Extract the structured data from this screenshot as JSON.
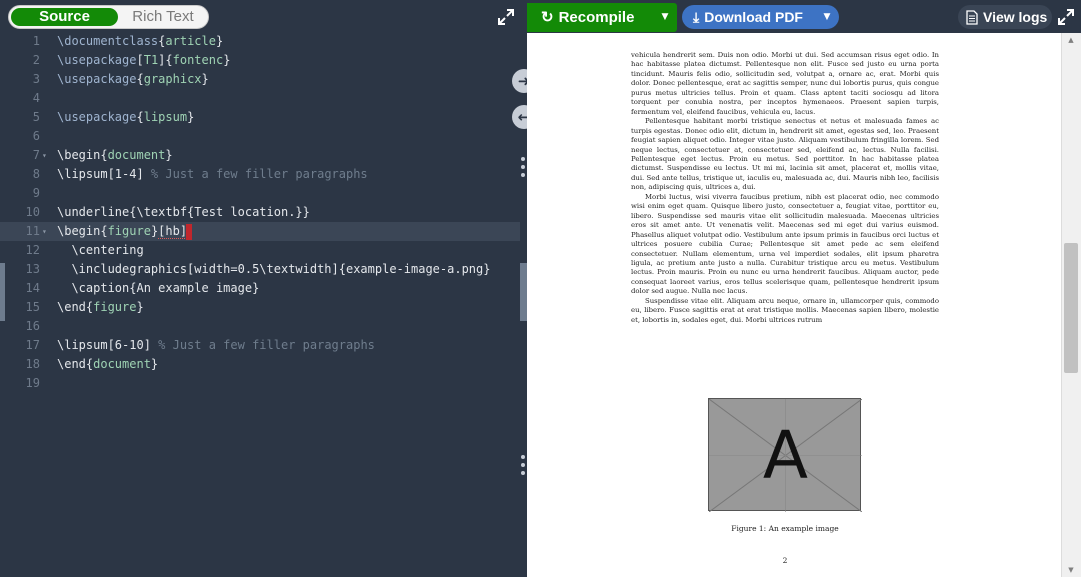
{
  "editor": {
    "mode_source": "Source",
    "mode_rich": "Rich Text",
    "expand_icon": "expand-icon",
    "lines": [
      {
        "n": "1",
        "parts": [
          [
            "cmd",
            "\\documentclass"
          ],
          [
            "kw",
            "{"
          ],
          [
            "arg",
            "article"
          ],
          [
            "kw",
            "}"
          ]
        ]
      },
      {
        "n": "2",
        "parts": [
          [
            "cmd",
            "\\usepackage"
          ],
          [
            "kw",
            "["
          ],
          [
            "arg",
            "T1"
          ],
          [
            "kw",
            "]{"
          ],
          [
            "arg",
            "fontenc"
          ],
          [
            "kw",
            "}"
          ]
        ]
      },
      {
        "n": "3",
        "parts": [
          [
            "cmd",
            "\\usepackage"
          ],
          [
            "kw",
            "{"
          ],
          [
            "arg",
            "graphicx"
          ],
          [
            "kw",
            "}"
          ]
        ]
      },
      {
        "n": "4",
        "parts": []
      },
      {
        "n": "5",
        "parts": [
          [
            "cmd",
            "\\usepackage"
          ],
          [
            "kw",
            "{"
          ],
          [
            "arg",
            "lipsum"
          ],
          [
            "kw",
            "}"
          ]
        ]
      },
      {
        "n": "6",
        "parts": []
      },
      {
        "n": "7",
        "fold": true,
        "parts": [
          [
            "kw",
            "\\begin{"
          ],
          [
            "arg",
            "document"
          ],
          [
            "kw",
            "}"
          ]
        ]
      },
      {
        "n": "8",
        "parts": [
          [
            "kw",
            "\\lipsum[1-4] "
          ],
          [
            "cm",
            "% Just a few filler paragraphs"
          ]
        ]
      },
      {
        "n": "9",
        "parts": []
      },
      {
        "n": "10",
        "parts": [
          [
            "kw",
            "\\underline{\\textbf{Test location.}}"
          ]
        ]
      },
      {
        "n": "11",
        "fold": true,
        "active": true,
        "parts": [
          [
            "kw",
            "\\begin{"
          ],
          [
            "arg",
            "figure"
          ],
          [
            "kw",
            "}"
          ],
          [
            "err",
            "[hb]"
          ]
        ]
      },
      {
        "n": "12",
        "parts": [
          [
            "kw",
            "  \\centering"
          ]
        ]
      },
      {
        "n": "13",
        "parts": [
          [
            "kw",
            "  \\includegraphics[width=0.5\\textwidth]{example-image-a.png}"
          ]
        ]
      },
      {
        "n": "14",
        "parts": [
          [
            "kw",
            "  \\caption{An example image}"
          ]
        ]
      },
      {
        "n": "15",
        "parts": [
          [
            "kw",
            "\\end{"
          ],
          [
            "arg",
            "figure"
          ],
          [
            "kw",
            "}"
          ]
        ]
      },
      {
        "n": "16",
        "parts": []
      },
      {
        "n": "17",
        "parts": [
          [
            "kw",
            "\\lipsum[6-10] "
          ],
          [
            "cm",
            "% Just a few filler paragraphs"
          ]
        ]
      },
      {
        "n": "18",
        "parts": [
          [
            "kw",
            "\\end{"
          ],
          [
            "arg",
            "document"
          ],
          [
            "kw",
            "}"
          ]
        ]
      },
      {
        "n": "19",
        "parts": []
      }
    ]
  },
  "pdf_toolbar": {
    "recompile_label": "Recompile",
    "download_label": "Download PDF",
    "logs_label": "View logs"
  },
  "pdf": {
    "paragraphs": [
      "vehicula hendrerit sem. Duis non odio. Morbi ut dui. Sed accumsan risus eget odio. In hac habitasse platea dictumst. Pellentesque non elit. Fusce sed justo eu urna porta tincidunt. Mauris felis odio, sollicitudin sed, volutpat a, ornare ac, erat. Morbi quis dolor. Donec pellentesque, erat ac sagittis semper, nunc dui lobortis purus, quis congue purus metus ultricies tellus. Proin et quam. Class aptent taciti sociosqu ad litora torquent per conubia nostra, per inceptos hymenaeos. Praesent sapien turpis, fermentum vel, eleifend faucibus, vehicula eu, lacus.",
      "Pellentesque habitant morbi tristique senectus et netus et malesuada fames ac turpis egestas. Donec odio elit, dictum in, hendrerit sit amet, egestas sed, leo. Praesent feugiat sapien aliquet odio. Integer vitae justo. Aliquam vestibulum fringilla lorem. Sed neque lectus, consectetuer at, consectetuer sed, eleifend ac, lectus. Nulla facilisi. Pellentesque eget lectus. Proin eu metus. Sed porttitor. In hac habitasse platea dictumst. Suspendisse eu lectus. Ut mi mi, lacinia sit amet, placerat et, mollis vitae, dui. Sed ante tellus, tristique ut, iaculis eu, malesuada ac, dui. Mauris nibh leo, facilisis non, adipiscing quis, ultrices a, dui.",
      "Morbi luctus, wisi viverra faucibus pretium, nibh est placerat odio, nec commodo wisi enim eget quam. Quisque libero justo, consectetuer a, feugiat vitae, porttitor eu, libero. Suspendisse sed mauris vitae elit sollicitudin malesuada. Maecenas ultricies eros sit amet ante. Ut venenatis velit. Maecenas sed mi eget dui varius euismod. Phasellus aliquet volutpat odio. Vestibulum ante ipsum primis in faucibus orci luctus et ultrices posuere cubilia Curae; Pellentesque sit amet pede ac sem eleifend consectetuer. Nullam elementum, urna vel imperdiet sodales, elit ipsum pharetra ligula, ac pretium ante justo a nulla. Curabitur tristique arcu eu metus. Vestibulum lectus. Proin mauris. Proin eu nunc eu urna hendrerit faucibus. Aliquam auctor, pede consequat laoreet varius, eros tellus scelerisque quam, pellentesque hendrerit ipsum dolor sed augue. Nulla nec lacus.",
      "Suspendisse vitae elit. Aliquam arcu neque, ornare in, ullamcorper quis, commodo eu, libero. Fusce sagittis erat at erat tristique mollis. Maecenas sapien libero, molestie et, lobortis in, sodales eget, dui. Morbi ultrices rutrum"
    ],
    "figure_letter": "A",
    "figure_caption": "Figure 1:  An example image",
    "page_number": "2"
  }
}
